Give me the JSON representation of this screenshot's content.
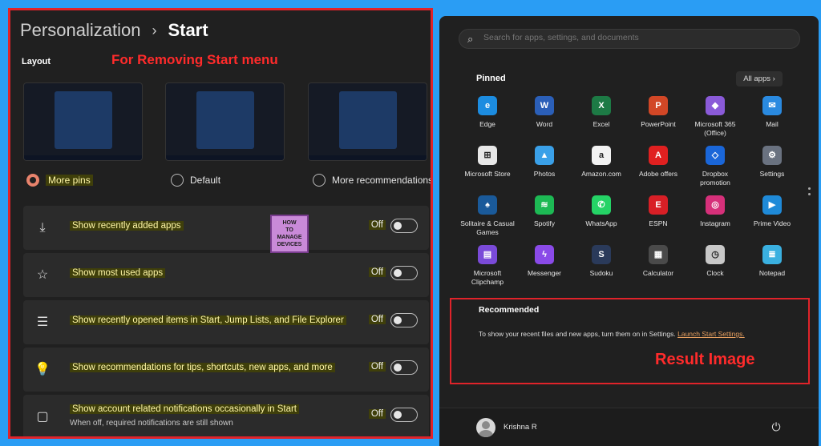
{
  "left": {
    "breadcrumb_parent": "Personalization",
    "breadcrumb_separator": "›",
    "breadcrumb_current": "Start",
    "layout_label": "Layout",
    "annotation": "For Removing Start menu",
    "radios": [
      {
        "label": "More pins",
        "selected": true
      },
      {
        "label": "Default",
        "selected": false
      },
      {
        "label": "More recommendations",
        "selected": false
      }
    ],
    "settings": [
      {
        "icon": "download-icon",
        "label": "Show recently added apps",
        "state": "Off"
      },
      {
        "icon": "star-icon",
        "label": "Show most used apps",
        "state": "Off"
      },
      {
        "icon": "list-icon",
        "label": "Show recently opened items in Start, Jump Lists, and File Explorer",
        "state": "Off"
      },
      {
        "icon": "lightbulb-icon",
        "label": "Show recommendations for tips, shortcuts, new apps, and more",
        "state": "Off"
      },
      {
        "icon": "notification-icon",
        "label": "Show account related notifications occasionally in Start",
        "sub": "When off, required notifications are still shown",
        "state": "Off"
      }
    ],
    "logo_lines": [
      "HOW",
      "TO",
      "MANAGE",
      "DEVICES"
    ]
  },
  "right": {
    "search_placeholder": "Search for apps, settings, and documents",
    "pinned_label": "Pinned",
    "all_apps_label": "All apps",
    "apps": [
      {
        "name": "Edge",
        "icon": "edge-icon",
        "color": "#1c8ce0"
      },
      {
        "name": "Word",
        "icon": "word-icon",
        "color": "#2b5fb8"
      },
      {
        "name": "Excel",
        "icon": "excel-icon",
        "color": "#1d7a45"
      },
      {
        "name": "PowerPoint",
        "icon": "powerpoint-icon",
        "color": "#d24726"
      },
      {
        "name": "Microsoft 365 (Office)",
        "icon": "office-icon",
        "color": "#8a5ad8"
      },
      {
        "name": "Mail",
        "icon": "mail-icon",
        "color": "#2a8ae0"
      },
      {
        "name": "Microsoft Store",
        "icon": "store-icon",
        "color": "#e8e8e8"
      },
      {
        "name": "Photos",
        "icon": "photos-icon",
        "color": "#3aa0e8"
      },
      {
        "name": "Amazon.com",
        "icon": "amazon-icon",
        "color": "#f2f2f2"
      },
      {
        "name": "Adobe offers",
        "icon": "adobe-icon",
        "color": "#e02020"
      },
      {
        "name": "Dropbox promotion",
        "icon": "dropbox-icon",
        "color": "#1a66d8"
      },
      {
        "name": "Settings",
        "icon": "settings-icon",
        "color": "#6a7280"
      },
      {
        "name": "Solitaire & Casual Games",
        "icon": "solitaire-icon",
        "color": "#1a5a9a"
      },
      {
        "name": "Spotify",
        "icon": "spotify-icon",
        "color": "#1db954"
      },
      {
        "name": "WhatsApp",
        "icon": "whatsapp-icon",
        "color": "#25d366"
      },
      {
        "name": "ESPN",
        "icon": "espn-icon",
        "color": "#d81f26"
      },
      {
        "name": "Instagram",
        "icon": "instagram-icon",
        "color": "#d6307a"
      },
      {
        "name": "Prime Video",
        "icon": "prime-video-icon",
        "color": "#1f8ad8"
      },
      {
        "name": "Microsoft Clipchamp",
        "icon": "clipchamp-icon",
        "color": "#7a4ad8"
      },
      {
        "name": "Messenger",
        "icon": "messenger-icon",
        "color": "#8a4ae8"
      },
      {
        "name": "Sudoku",
        "icon": "sudoku-icon",
        "color": "#2a3a5a"
      },
      {
        "name": "Calculator",
        "icon": "calculator-icon",
        "color": "#4a4a4a"
      },
      {
        "name": "Clock",
        "icon": "clock-icon",
        "color": "#c8c8c8"
      },
      {
        "name": "Notepad",
        "icon": "notepad-icon",
        "color": "#3ab0e0"
      }
    ],
    "recommended_title": "Recommended",
    "recommended_text": "To show your recent files and new apps, turn them on in Settings.",
    "recommended_link": "Launch Start Settings.",
    "annotation": "Result Image",
    "user_name": "Krishna R"
  }
}
